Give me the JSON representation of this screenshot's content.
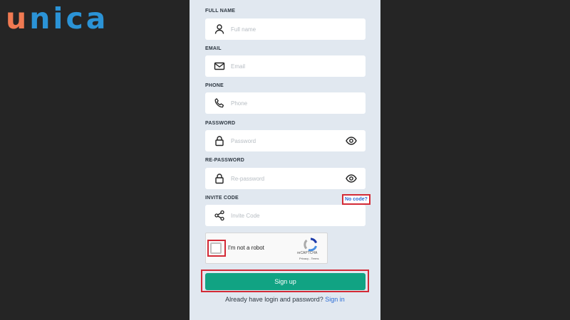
{
  "brand": {
    "logo_u": "u",
    "logo_rest": "nica"
  },
  "form": {
    "full_name": {
      "label": "FULL NAME",
      "placeholder": "Full name",
      "icon": "user-icon"
    },
    "email": {
      "label": "EMAIL",
      "placeholder": "Email",
      "icon": "mail-icon"
    },
    "phone": {
      "label": "PHONE",
      "placeholder": "Phone",
      "icon": "phone-icon"
    },
    "password": {
      "label": "PASSWORD",
      "placeholder": "Password",
      "icon": "lock-icon"
    },
    "re_password": {
      "label": "RE-PASSWORD",
      "placeholder": "Re-password",
      "icon": "lock-icon"
    },
    "invite_code": {
      "label": "INVITE CODE",
      "placeholder": "Invite Code",
      "icon": "share-icon",
      "no_code_link": "No code?"
    }
  },
  "captcha": {
    "label": "I'm not a robot",
    "brand": "reCAPTCHA",
    "links": "Privacy - Terms"
  },
  "signup_button": "Sign up",
  "footer": {
    "text": "Already have login and password?",
    "link": "Sign in"
  },
  "colors": {
    "background": "#252525",
    "panel": "#e1e8f0",
    "primary": "#11a383",
    "link": "#2b6cd6",
    "highlight": "#d32a36",
    "logo_orange": "#f07a52",
    "logo_blue": "#2b93d6"
  }
}
